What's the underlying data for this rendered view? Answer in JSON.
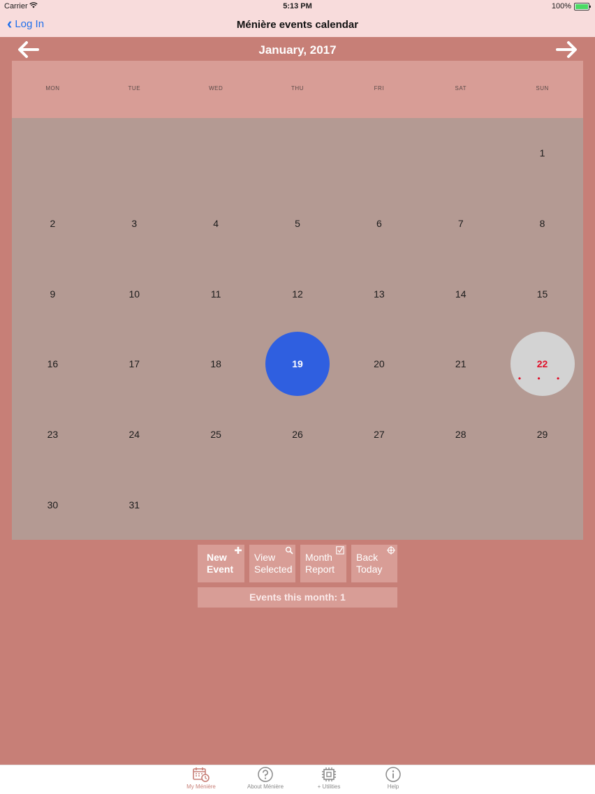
{
  "statusbar": {
    "carrier": "Carrier",
    "time": "5:13 PM",
    "battery": "100%"
  },
  "navbar": {
    "back_label": "Log In",
    "title": "Ménière events calendar"
  },
  "calendar": {
    "month_title": "January, 2017",
    "weekdays": [
      "MON",
      "TUE",
      "WED",
      "THU",
      "FRI",
      "SAT",
      "SUN"
    ],
    "leading_blanks": 6,
    "days_in_month": 31,
    "selected_day": 19,
    "today_day": 22,
    "event_dots": "• • •",
    "colors": {
      "selected": "#2f5fe0",
      "today_bg": "#d3d3d3",
      "today_text": "#e0102a",
      "grid_bg": "#b49a93",
      "header_bg": "#d89d96"
    }
  },
  "actions": {
    "new_event": [
      "New",
      "Event"
    ],
    "view_selected": [
      "View",
      "Selected"
    ],
    "month_report": [
      "Month",
      "Report"
    ],
    "back_today": [
      "Back",
      "Today"
    ],
    "icons": {
      "new_event": "plus-icon",
      "view_selected": "magnifier-icon",
      "month_report": "checkbox-icon",
      "back_today": "crosshair-icon"
    }
  },
  "summary": {
    "events_this_month": "Events this month: 1"
  },
  "tabbar": {
    "items": [
      {
        "label": "My Ménière",
        "icon": "calendar-clock-icon",
        "active": true
      },
      {
        "label": "About Ménière",
        "icon": "question-circle-icon",
        "active": false
      },
      {
        "label": "+ Utilities",
        "icon": "chip-icon",
        "active": false
      },
      {
        "label": "Help",
        "icon": "info-circle-icon",
        "active": false
      }
    ]
  }
}
